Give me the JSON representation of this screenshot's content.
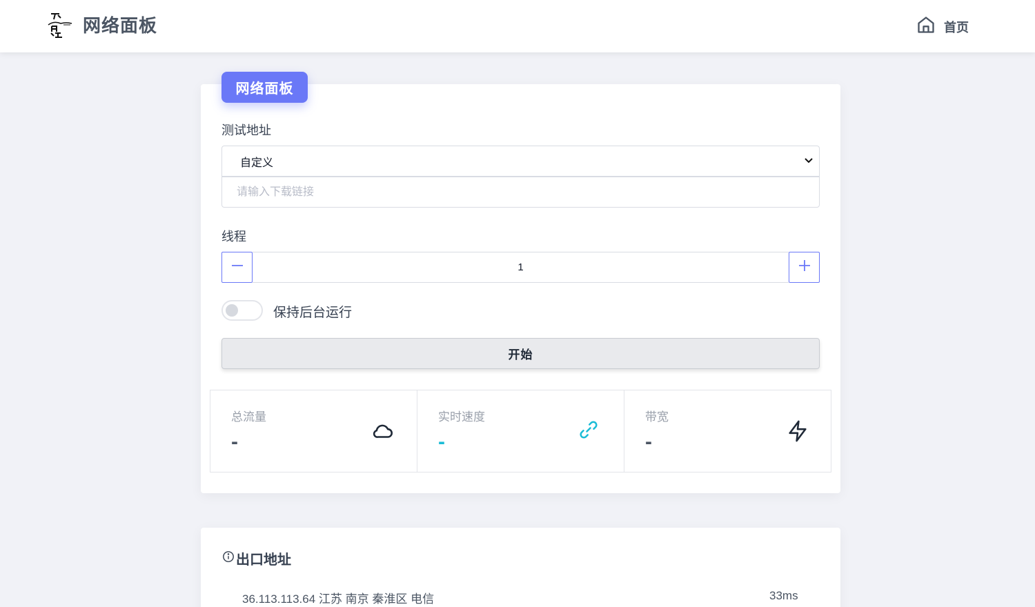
{
  "header": {
    "brand_title": "网络面板",
    "home_label": "首页"
  },
  "panel": {
    "badge": "网络面板",
    "test_address_label": "测试地址",
    "select_value": "自定义",
    "url_placeholder": "请输入下载链接",
    "threads_label": "线程",
    "threads_value": "1",
    "keep_background_label": "保持后台运行",
    "keep_background_on": false,
    "start_label": "开始"
  },
  "stats": [
    {
      "label": "总流量",
      "value": "-",
      "icon": "cloud-icon"
    },
    {
      "label": "实时速度",
      "value": "-",
      "icon": "link-icon",
      "color": "#1bbcd6"
    },
    {
      "label": "带宽",
      "value": "-",
      "icon": "lightning-icon"
    }
  ],
  "exit": {
    "title": "出口地址",
    "rows": [
      {
        "address": "36.113.113.64 江苏 南京 秦淮区 电信",
        "latency": "33ms"
      }
    ]
  },
  "colors": {
    "accent": "#6a78f7",
    "cyan": "#1bbcd6",
    "background": "#f1f2f7"
  }
}
